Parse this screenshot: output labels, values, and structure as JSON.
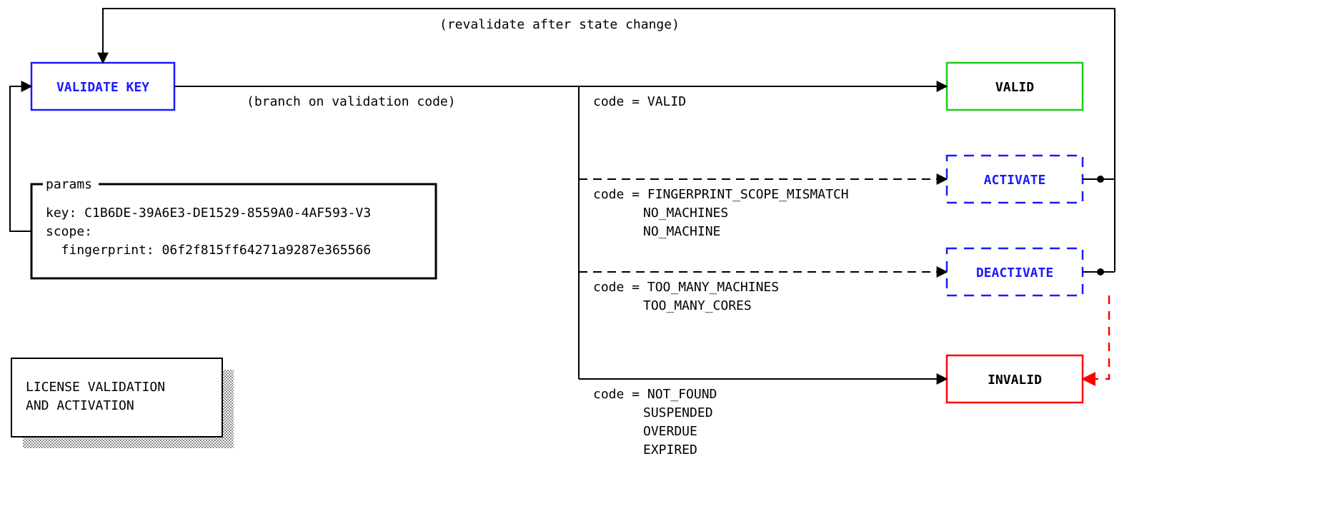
{
  "title_block": {
    "line1": "LICENSE VALIDATION",
    "line2": "AND ACTIVATION"
  },
  "validate_node": {
    "label": "VALIDATE KEY"
  },
  "params": {
    "legend": "params",
    "key_line": "key: C1B6DE-39A6E3-DE1529-8559A0-4AF593-V3",
    "scope_line": "scope:",
    "fingerprint_line": "  fingerprint: 06f2f815ff64271a9287e365566"
  },
  "edges": {
    "branch_note": "(branch on validation code)",
    "revalidate_note": "(revalidate after state change)"
  },
  "branches": {
    "valid": {
      "node_label": "VALID",
      "code_prefix": "code = ",
      "code_values": [
        "VALID"
      ]
    },
    "activate": {
      "node_label": "ACTIVATE",
      "code_prefix": "code = ",
      "code_values": [
        "FINGERPRINT_SCOPE_MISMATCH",
        "NO_MACHINES",
        "NO_MACHINE"
      ]
    },
    "deactivate": {
      "node_label": "DEACTIVATE",
      "code_prefix": "code = ",
      "code_values": [
        "TOO_MANY_MACHINES",
        "TOO_MANY_CORES"
      ]
    },
    "invalid": {
      "node_label": "INVALID",
      "code_prefix": "code = ",
      "code_values": [
        "NOT_FOUND",
        "SUSPENDED",
        "OVERDUE",
        "EXPIRED"
      ]
    }
  },
  "colors": {
    "blue": "#1a1aff",
    "green": "#18d018",
    "red": "#ff0000",
    "black": "#000000"
  }
}
